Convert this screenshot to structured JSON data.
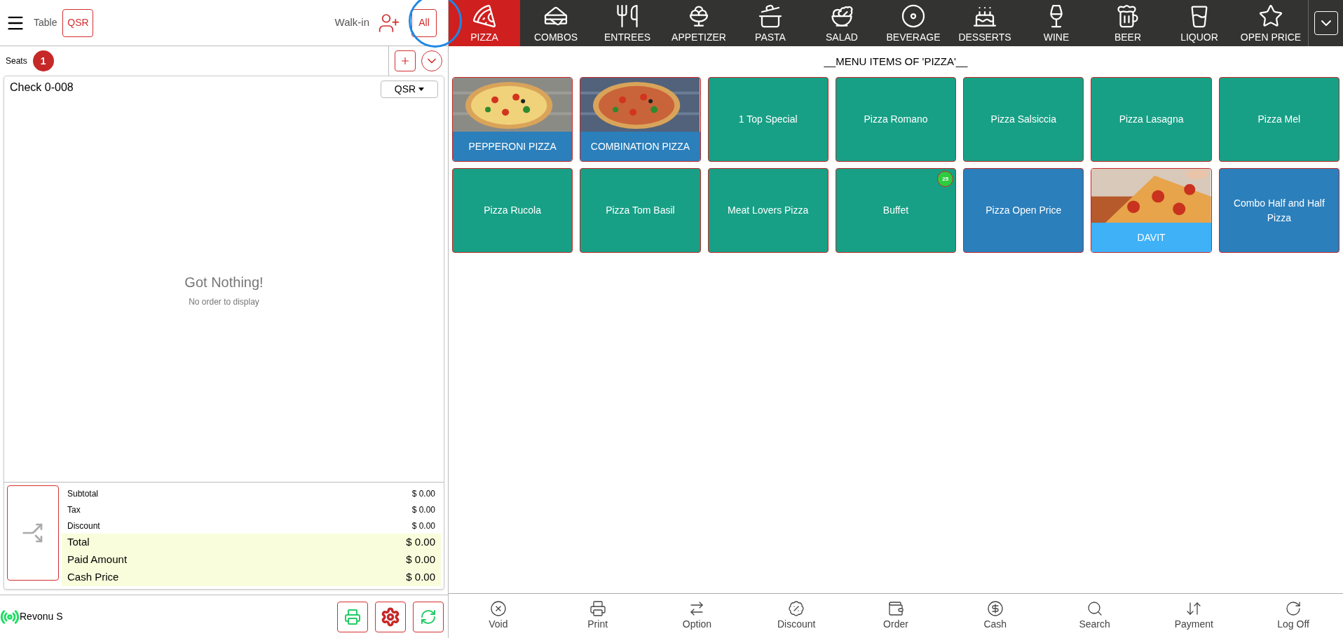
{
  "header": {
    "menu_label": "Table",
    "order_type": "QSR",
    "customer": "Walk-in",
    "filter": "All"
  },
  "seats": {
    "label": "Seats",
    "count": "1"
  },
  "check": {
    "title": "Check 0-008",
    "type": "QSR",
    "empty_title": "Got Nothing!",
    "empty_subtitle": "No order to display"
  },
  "totals": [
    {
      "label": "Subtotal",
      "value": "$ 0.00",
      "kind": "minor"
    },
    {
      "label": "Tax",
      "value": "$ 0.00",
      "kind": "minor"
    },
    {
      "label": "Discount",
      "value": "$ 0.00",
      "kind": "minor"
    },
    {
      "label": "Total",
      "value": "$ 0.00",
      "kind": "major"
    },
    {
      "label": "Paid Amount",
      "value": "$ 0.00",
      "kind": "major"
    },
    {
      "label": "Cash Price",
      "value": "$ 0.00",
      "kind": "major"
    }
  ],
  "status": {
    "label": "Revonu S"
  },
  "categories": [
    {
      "label": "PIZZA",
      "selected": true
    },
    {
      "label": "COMBOS",
      "selected": false
    },
    {
      "label": "ENTREES",
      "selected": false
    },
    {
      "label": "APPETIZER",
      "selected": false
    },
    {
      "label": "PASTA",
      "selected": false
    },
    {
      "label": "SALAD",
      "selected": false
    },
    {
      "label": "BEVERAGE",
      "selected": false
    },
    {
      "label": "DESSERTS",
      "selected": false
    },
    {
      "label": "WINE",
      "selected": false
    },
    {
      "label": "BEER",
      "selected": false
    },
    {
      "label": "LIQUOR",
      "selected": false
    },
    {
      "label": "OPEN PRICE",
      "selected": false
    }
  ],
  "menu_title": "__MENU ITEMS OF 'PIZZA'__",
  "items": [
    {
      "label": "PEPPERONI PIZZA",
      "kind": "picture",
      "color": "#2b7fbb"
    },
    {
      "label": "COMBINATION PIZZA",
      "kind": "picture",
      "color": "#2b7fbb"
    },
    {
      "label": "1 Top Special",
      "kind": "plain",
      "color": "#17a086"
    },
    {
      "label": "Pizza Romano",
      "kind": "plain",
      "color": "#17a086"
    },
    {
      "label": "Pizza Salsiccia",
      "kind": "plain",
      "color": "#17a086"
    },
    {
      "label": "Pizza Lasagna",
      "kind": "plain",
      "color": "#17a086"
    },
    {
      "label": "Pizza Mel",
      "kind": "plain",
      "color": "#17a086"
    },
    {
      "label": "Pizza Rucola",
      "kind": "plain",
      "color": "#17a086"
    },
    {
      "label": "Pizza Tom Basil",
      "kind": "plain",
      "color": "#17a086"
    },
    {
      "label": "Meat Lovers Pizza",
      "kind": "plain",
      "color": "#17a086"
    },
    {
      "label": "Buffet",
      "kind": "plain",
      "color": "#17a086",
      "badge": "25"
    },
    {
      "label": "Pizza Open Price",
      "kind": "plain",
      "color": "#2b7fbb"
    },
    {
      "label": "DAVIT",
      "kind": "picture",
      "color": "#3eb1f7"
    },
    {
      "label": "Combo Half and Half Pizza",
      "kind": "plain",
      "color": "#2b7fbb"
    }
  ],
  "actions": [
    "Void",
    "Print",
    "Option",
    "Discount",
    "Order",
    "Cash",
    "Search",
    "Payment",
    "Log Off"
  ]
}
